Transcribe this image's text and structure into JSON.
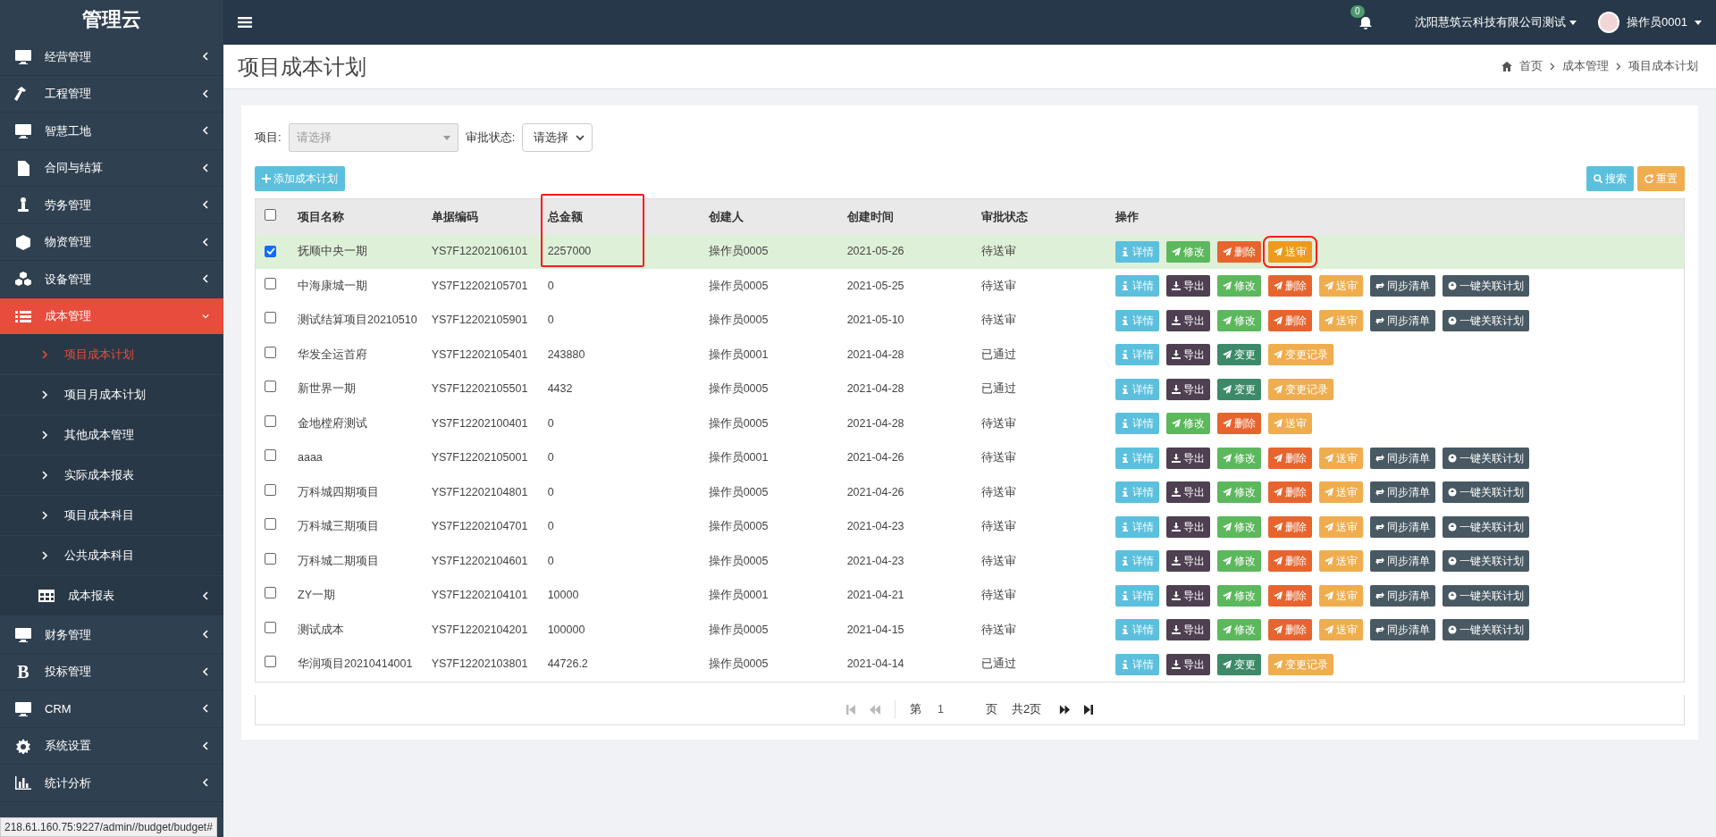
{
  "sidebar": {
    "brand": "管理云",
    "items": [
      {
        "label": "经营管理",
        "kind": "monitor",
        "active": false,
        "expanded": false
      },
      {
        "label": "工程管理",
        "kind": "hammer",
        "active": false,
        "expanded": false
      },
      {
        "label": "智慧工地",
        "kind": "monitor",
        "active": false,
        "expanded": false
      },
      {
        "label": "合同与结算",
        "kind": "file",
        "active": false,
        "expanded": false
      },
      {
        "label": "劳务管理",
        "kind": "worker",
        "active": false,
        "expanded": false
      },
      {
        "label": "物资管理",
        "kind": "cube",
        "active": false,
        "expanded": false
      },
      {
        "label": "设备管理",
        "kind": "cubes",
        "active": false,
        "expanded": false
      },
      {
        "label": "成本管理",
        "kind": "list",
        "active": true,
        "expanded": true,
        "children": [
          {
            "label": "项目成本计划",
            "kind": "link",
            "selected": true
          },
          {
            "label": "项目月成本计划",
            "kind": "link",
            "selected": false
          },
          {
            "label": "其他成本管理",
            "kind": "link",
            "selected": false
          },
          {
            "label": "实际成本报表",
            "kind": "link",
            "selected": false
          },
          {
            "label": "项目成本科目",
            "kind": "link",
            "selected": false
          },
          {
            "label": "公共成本科目",
            "kind": "link",
            "selected": false
          },
          {
            "label": "成本报表",
            "kind": "group",
            "selected": false
          }
        ]
      },
      {
        "label": "财务管理",
        "kind": "monitor",
        "active": false,
        "expanded": false
      },
      {
        "label": "投标管理",
        "kind": "glyph",
        "glyph": "B",
        "active": false,
        "expanded": false
      },
      {
        "label": "CRM",
        "kind": "monitor",
        "active": false,
        "expanded": false
      },
      {
        "label": "系统设置",
        "kind": "gear",
        "active": false,
        "expanded": false
      },
      {
        "label": "统计分析",
        "kind": "chart",
        "active": false,
        "expanded": false
      }
    ]
  },
  "topbar": {
    "notifications": "0",
    "company": "沈阳慧筑云科技有限公司测试",
    "user": "操作员0001"
  },
  "page_header": {
    "title": "项目成本计划",
    "breadcrumb": [
      "首页",
      "成本管理",
      "项目成本计划"
    ]
  },
  "filters": [
    {
      "label": "项目:",
      "placeholder": "请选择",
      "kind": "combo"
    },
    {
      "label": "审批状态:",
      "placeholder": "请选择",
      "kind": "select"
    }
  ],
  "toolbar": {
    "add": "添加成本计划",
    "search": "搜索",
    "reset": "重置"
  },
  "table": {
    "select_all_checked": false,
    "columns": [
      {
        "label": "项目名称",
        "highlighted": false
      },
      {
        "label": "单据编码",
        "highlighted": false
      },
      {
        "label": "总金额",
        "highlighted": true
      },
      {
        "label": "创建人",
        "highlighted": false
      },
      {
        "label": "创建时间",
        "highlighted": false
      },
      {
        "label": "审批状态",
        "highlighted": false
      },
      {
        "label": "操作",
        "highlighted": false
      }
    ],
    "rows": [
      {
        "selected": true,
        "cells": [
          "抚顺中央一期",
          "YS7F12202106101",
          "2257000",
          "操作员0005",
          "2021-05-26",
          "待送审"
        ],
        "actions": [
          {
            "kind": "detail",
            "label": "详情",
            "highlighted": false
          },
          {
            "kind": "edit",
            "label": "修改",
            "highlighted": false
          },
          {
            "kind": "delete",
            "label": "删除",
            "highlighted": false
          },
          {
            "kind": "submit",
            "label": "送审",
            "highlighted": true
          }
        ]
      },
      {
        "selected": false,
        "cells": [
          "中海康城一期",
          "YS7F12202105701",
          "0",
          "操作员0005",
          "2021-05-25",
          "待送审"
        ],
        "actions": [
          {
            "kind": "detail",
            "label": "详情",
            "highlighted": false
          },
          {
            "kind": "export",
            "label": "导出",
            "highlighted": false
          },
          {
            "kind": "edit",
            "label": "修改",
            "highlighted": false
          },
          {
            "kind": "delete",
            "label": "删除",
            "highlighted": false
          },
          {
            "kind": "submit",
            "label": "送审",
            "highlighted": false
          },
          {
            "kind": "sync",
            "label": "同步清单",
            "highlighted": false
          },
          {
            "kind": "link",
            "label": "一键关联计划",
            "highlighted": false
          }
        ]
      },
      {
        "selected": false,
        "cells": [
          "测试结算项目20210510",
          "YS7F12202105901",
          "0",
          "操作员0005",
          "2021-05-10",
          "待送审"
        ],
        "actions": [
          {
            "kind": "detail",
            "label": "详情",
            "highlighted": false
          },
          {
            "kind": "export",
            "label": "导出",
            "highlighted": false
          },
          {
            "kind": "edit",
            "label": "修改",
            "highlighted": false
          },
          {
            "kind": "delete",
            "label": "删除",
            "highlighted": false
          },
          {
            "kind": "submit",
            "label": "送审",
            "highlighted": false
          },
          {
            "kind": "sync",
            "label": "同步清单",
            "highlighted": false
          },
          {
            "kind": "link",
            "label": "一键关联计划",
            "highlighted": false
          }
        ]
      },
      {
        "selected": false,
        "cells": [
          "华发全运首府",
          "YS7F12202105401",
          "243880",
          "操作员0001",
          "2021-04-28",
          "已通过"
        ],
        "actions": [
          {
            "kind": "detail",
            "label": "详情",
            "highlighted": false
          },
          {
            "kind": "export",
            "label": "导出",
            "highlighted": false
          },
          {
            "kind": "change",
            "label": "变更",
            "highlighted": false
          },
          {
            "kind": "history",
            "label": "变更记录",
            "highlighted": false
          }
        ]
      },
      {
        "selected": false,
        "cells": [
          "新世界一期",
          "YS7F12202105501",
          "4432",
          "操作员0005",
          "2021-04-28",
          "已通过"
        ],
        "actions": [
          {
            "kind": "detail",
            "label": "详情",
            "highlighted": false
          },
          {
            "kind": "export",
            "label": "导出",
            "highlighted": false
          },
          {
            "kind": "change",
            "label": "变更",
            "highlighted": false
          },
          {
            "kind": "history",
            "label": "变更记录",
            "highlighted": false
          }
        ]
      },
      {
        "selected": false,
        "cells": [
          "金地樘府测试",
          "YS7F12202100401",
          "0",
          "操作员0005",
          "2021-04-28",
          "待送审"
        ],
        "actions": [
          {
            "kind": "detail",
            "label": "详情",
            "highlighted": false
          },
          {
            "kind": "edit",
            "label": "修改",
            "highlighted": false
          },
          {
            "kind": "delete",
            "label": "删除",
            "highlighted": false
          },
          {
            "kind": "submit",
            "label": "送审",
            "highlighted": false
          }
        ]
      },
      {
        "selected": false,
        "cells": [
          "aaaa",
          "YS7F12202105001",
          "0",
          "操作员0001",
          "2021-04-26",
          "待送审"
        ],
        "actions": [
          {
            "kind": "detail",
            "label": "详情",
            "highlighted": false
          },
          {
            "kind": "export",
            "label": "导出",
            "highlighted": false
          },
          {
            "kind": "edit",
            "label": "修改",
            "highlighted": false
          },
          {
            "kind": "delete",
            "label": "删除",
            "highlighted": false
          },
          {
            "kind": "submit",
            "label": "送审",
            "highlighted": false
          },
          {
            "kind": "sync",
            "label": "同步清单",
            "highlighted": false
          },
          {
            "kind": "link",
            "label": "一键关联计划",
            "highlighted": false
          }
        ]
      },
      {
        "selected": false,
        "cells": [
          "万科城四期项目",
          "YS7F12202104801",
          "0",
          "操作员0005",
          "2021-04-26",
          "待送审"
        ],
        "actions": [
          {
            "kind": "detail",
            "label": "详情",
            "highlighted": false
          },
          {
            "kind": "export",
            "label": "导出",
            "highlighted": false
          },
          {
            "kind": "edit",
            "label": "修改",
            "highlighted": false
          },
          {
            "kind": "delete",
            "label": "删除",
            "highlighted": false
          },
          {
            "kind": "submit",
            "label": "送审",
            "highlighted": false
          },
          {
            "kind": "sync",
            "label": "同步清单",
            "highlighted": false
          },
          {
            "kind": "link",
            "label": "一键关联计划",
            "highlighted": false
          }
        ]
      },
      {
        "selected": false,
        "cells": [
          "万科城三期项目",
          "YS7F12202104701",
          "0",
          "操作员0005",
          "2021-04-23",
          "待送审"
        ],
        "actions": [
          {
            "kind": "detail",
            "label": "详情",
            "highlighted": false
          },
          {
            "kind": "export",
            "label": "导出",
            "highlighted": false
          },
          {
            "kind": "edit",
            "label": "修改",
            "highlighted": false
          },
          {
            "kind": "delete",
            "label": "删除",
            "highlighted": false
          },
          {
            "kind": "submit",
            "label": "送审",
            "highlighted": false
          },
          {
            "kind": "sync",
            "label": "同步清单",
            "highlighted": false
          },
          {
            "kind": "link",
            "label": "一键关联计划",
            "highlighted": false
          }
        ]
      },
      {
        "selected": false,
        "cells": [
          "万科城二期项目",
          "YS7F12202104601",
          "0",
          "操作员0005",
          "2021-04-23",
          "待送审"
        ],
        "actions": [
          {
            "kind": "detail",
            "label": "详情",
            "highlighted": false
          },
          {
            "kind": "export",
            "label": "导出",
            "highlighted": false
          },
          {
            "kind": "edit",
            "label": "修改",
            "highlighted": false
          },
          {
            "kind": "delete",
            "label": "删除",
            "highlighted": false
          },
          {
            "kind": "submit",
            "label": "送审",
            "highlighted": false
          },
          {
            "kind": "sync",
            "label": "同步清单",
            "highlighted": false
          },
          {
            "kind": "link",
            "label": "一键关联计划",
            "highlighted": false
          }
        ]
      },
      {
        "selected": false,
        "cells": [
          "ZY一期",
          "YS7F12202104101",
          "10000",
          "操作员0001",
          "2021-04-21",
          "待送审"
        ],
        "actions": [
          {
            "kind": "detail",
            "label": "详情",
            "highlighted": false
          },
          {
            "kind": "export",
            "label": "导出",
            "highlighted": false
          },
          {
            "kind": "edit",
            "label": "修改",
            "highlighted": false
          },
          {
            "kind": "delete",
            "label": "删除",
            "highlighted": false
          },
          {
            "kind": "submit",
            "label": "送审",
            "highlighted": false
          },
          {
            "kind": "sync",
            "label": "同步清单",
            "highlighted": false
          },
          {
            "kind": "link",
            "label": "一键关联计划",
            "highlighted": false
          }
        ]
      },
      {
        "selected": false,
        "cells": [
          "测试成本",
          "YS7F12202104201",
          "100000",
          "操作员0005",
          "2021-04-15",
          "待送审"
        ],
        "actions": [
          {
            "kind": "detail",
            "label": "详情",
            "highlighted": false
          },
          {
            "kind": "export",
            "label": "导出",
            "highlighted": false
          },
          {
            "kind": "edit",
            "label": "修改",
            "highlighted": false
          },
          {
            "kind": "delete",
            "label": "删除",
            "highlighted": false
          },
          {
            "kind": "submit",
            "label": "送审",
            "highlighted": false
          },
          {
            "kind": "sync",
            "label": "同步清单",
            "highlighted": false
          },
          {
            "kind": "link",
            "label": "一键关联计划",
            "highlighted": false
          }
        ]
      },
      {
        "selected": false,
        "cells": [
          "华润项目20210414001",
          "YS7F12202103801",
          "44726.2",
          "操作员0005",
          "2021-04-14",
          "已通过"
        ],
        "actions": [
          {
            "kind": "detail",
            "label": "详情",
            "highlighted": false
          },
          {
            "kind": "export",
            "label": "导出",
            "highlighted": false
          },
          {
            "kind": "change",
            "label": "变更",
            "highlighted": false
          },
          {
            "kind": "history",
            "label": "变更记录",
            "highlighted": false
          }
        ]
      }
    ]
  },
  "pager": {
    "prefix": "第",
    "page": "1",
    "suffix": "页",
    "total": "共2页",
    "first_disabled": true,
    "last_disabled": false
  },
  "status_bar": "218.61.160.75:9227/admin//budget/budget#"
}
